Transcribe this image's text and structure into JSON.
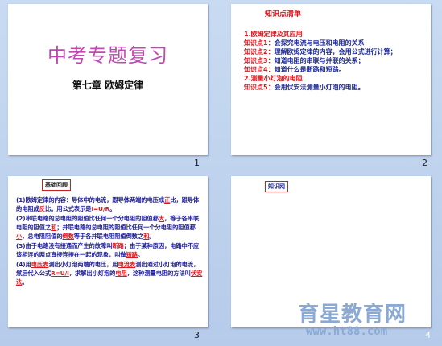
{
  "slides": [
    {
      "number": "1",
      "title": "中考专题复习",
      "subtitle": "第七章    欧姆定律"
    },
    {
      "number": "2",
      "heading": "知识点清单",
      "lines": [
        {
          "label": "1.",
          "text": "欧姆定律及其应用"
        },
        {
          "label": "知识点1：",
          "text": "会探究电流与电压和电阻的关系"
        },
        {
          "label": "知识点2：",
          "text": "理解欧姆定律的内容，会用公式进行计算；"
        },
        {
          "label": "知识点3：",
          "text": "知道电阻的串联与并联的关系；"
        },
        {
          "label": "知识点4：",
          "text": "知道什么是断路和短路。"
        },
        {
          "label": "2.",
          "text": "测量小灯泡的电阻"
        },
        {
          "label": "知识点5：",
          "text": "会用伏安法测量小灯泡的电阻。"
        }
      ]
    },
    {
      "number": "3",
      "tag": "基础回顾",
      "paragraphs": [
        [
          "(1)欧姆定律的内容：导体中的电流，跟导体两端的电压成",
          "正",
          "比，跟导体的电阻成",
          "反",
          "比。用公式表示是",
          "I=U/R",
          "。"
        ],
        [
          "(2)串联电路的总电阻的阻值比任何一个分电阻的阻值都",
          "大",
          "，等于各串联电阻的阻值之",
          "和",
          "；并联电路的总电阻的阻值比任何一个分电阻的阻值都",
          "小",
          "，总电阻阻值的",
          "倒数",
          "等于各并联电阻阻值倒数之",
          "和",
          "。"
        ],
        [
          "(3)由于电路没有接通而产生的故障叫",
          "断路",
          "；由于某种原因，电路中不应该相连的两点直接连接在一起的现象，叫做",
          "短路",
          "。"
        ],
        [
          "(4)用",
          "电压表",
          "测出小灯泡两端的电压，用",
          "电流表",
          "测出通过小灯泡的电流，然后代入公式",
          "R=U/I",
          "，求解出小灯泡的",
          "电阻",
          "，这种测量电阻的方法叫",
          "伏安法",
          "。"
        ]
      ]
    },
    {
      "number": "4",
      "tag": "知识网"
    }
  ],
  "watermark": {
    "title": "育星教育网",
    "url": "www.ht88.com"
  }
}
